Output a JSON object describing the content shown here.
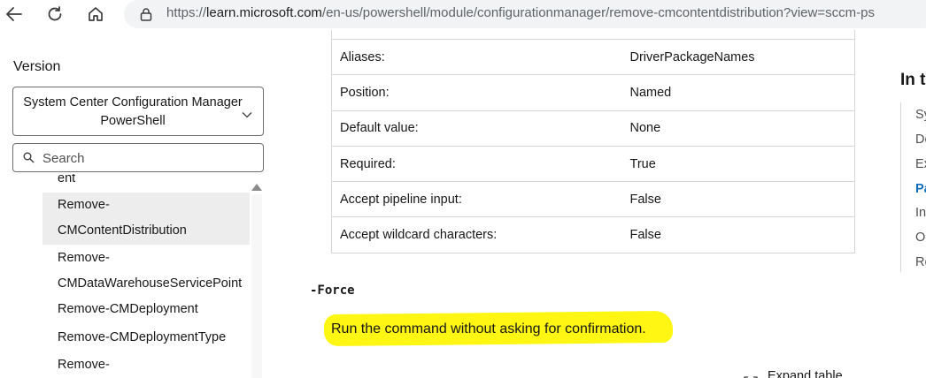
{
  "browser": {
    "url_prefix": "https://",
    "url_domain": "learn.microsoft.com",
    "url_path": "/en-us/powershell/module/configurationmanager/remove-cmcontentdistribution?view=sccm-ps"
  },
  "sidebar": {
    "version_label": "Version",
    "version_selected": "System Center Configuration Manager PowerShell",
    "search_placeholder": "Search",
    "toc_items": [
      {
        "label": "ent"
      },
      {
        "label": "Remove-CMContentDistribution",
        "line1": "Remove-",
        "line2": "CMContentDistribution",
        "active": true
      },
      {
        "label": "Remove-CMDataWarehouseServicePoint",
        "line1": "Remove-",
        "line2": "CMDataWarehouseServicePoint"
      },
      {
        "label": "Remove-CMDeployment"
      },
      {
        "label": "Remove-CMDeploymentType"
      },
      {
        "label": "Remove-"
      }
    ]
  },
  "param_table": {
    "rows": [
      {
        "key": "Aliases:",
        "value": "DriverPackageNames"
      },
      {
        "key": "Position:",
        "value": "Named"
      },
      {
        "key": "Default value:",
        "value": "None"
      },
      {
        "key": "Required:",
        "value": "True"
      },
      {
        "key": "Accept pipeline input:",
        "value": "False"
      },
      {
        "key": "Accept wildcard characters:",
        "value": "False"
      }
    ]
  },
  "parameter": {
    "name": "-Force",
    "description": "Run the command without asking for confirmation.",
    "expand_table_label": "Expand table"
  },
  "in_this_article": {
    "heading": "In t",
    "items": [
      {
        "label": "Sy"
      },
      {
        "label": "De"
      },
      {
        "label": "Ex"
      },
      {
        "label": "Pa",
        "active": true
      },
      {
        "label": "In"
      },
      {
        "label": "O"
      },
      {
        "label": "Re"
      }
    ]
  },
  "colors": {
    "highlight": "#fff500",
    "link_active": "#0f6cbd",
    "toc_active_bg": "#ededed"
  }
}
